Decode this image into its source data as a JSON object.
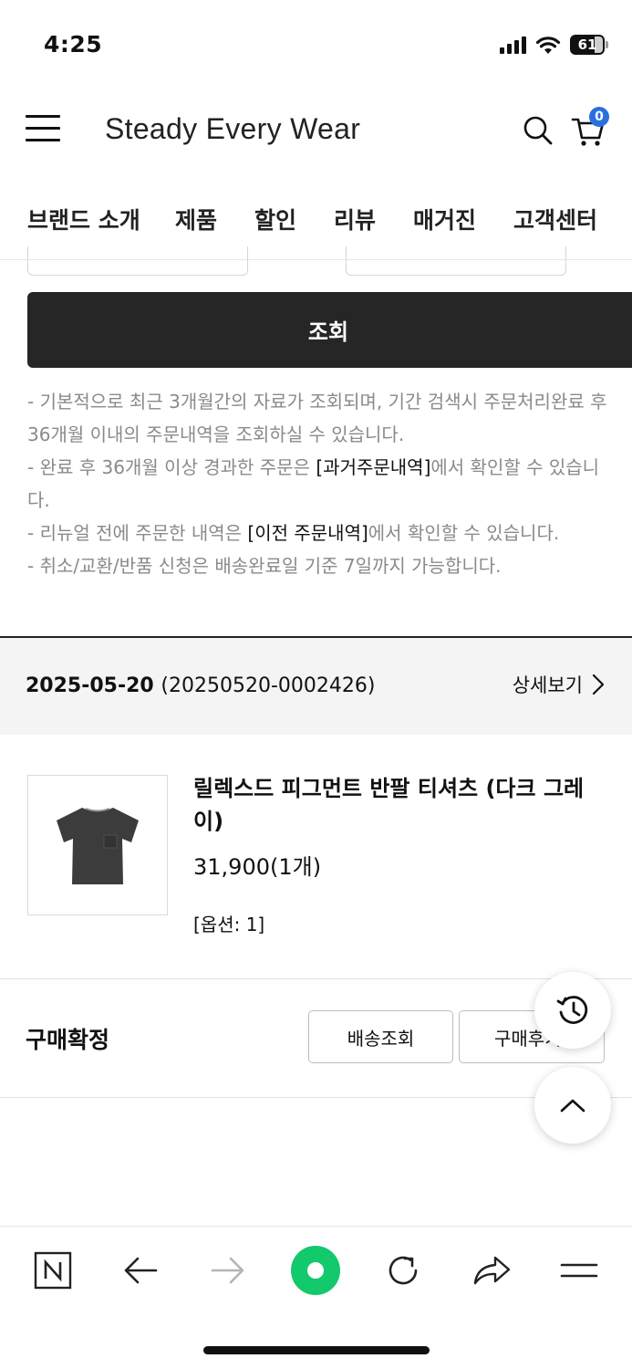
{
  "status_bar": {
    "time": "4:25",
    "battery": "61"
  },
  "header": {
    "brand": "Steady Every Wear",
    "cart_count": "0"
  },
  "nav": {
    "items": [
      "브랜드 소개",
      "제품",
      "할인",
      "리뷰",
      "매거진",
      "고객센터"
    ]
  },
  "search": {
    "submit_label": "조회"
  },
  "notices": {
    "line1": "- 기본적으로 최근 3개월간의 자료가 조회되며, 기간 검색시 주문처리완료 후 36개월 이내의 주문내역을 조회하실 수 있습니다.",
    "line2_pre": "- 완료 후 36개월 이상 경과한 주문은 ",
    "line2_link": "[과거주문내역]",
    "line2_post": "에서 확인할 수 있습니다.",
    "line3_pre": "- 리뉴얼 전에 주문한 내역은 ",
    "line3_link": "[이전 주문내역]",
    "line3_post": "에서 확인할 수 있습니다.",
    "line4": "- 취소/교환/반품 신청은 배송완료일 기준 7일까지 가능합니다."
  },
  "order": {
    "date": "2025-05-20",
    "number": "(20250520-0002426)",
    "detail_label": "상세보기",
    "product_name": "릴렉스드 피그먼트 반팔 티셔츠 (다크 그레이)",
    "price": "31,900(1개)",
    "option": "[옵션: 1]",
    "status": "구매확정",
    "track_label": "배송조회",
    "review_label": "구매후기"
  },
  "colors": {
    "badge": "#2a6fe0",
    "button_dark": "#262626",
    "toolbar_green": "#12c96b"
  },
  "toolbar": {
    "items": [
      "naver-n-icon",
      "back-arrow-icon",
      "forward-arrow-icon",
      "green-home-icon",
      "refresh-icon",
      "share-icon",
      "menu-icon"
    ]
  }
}
